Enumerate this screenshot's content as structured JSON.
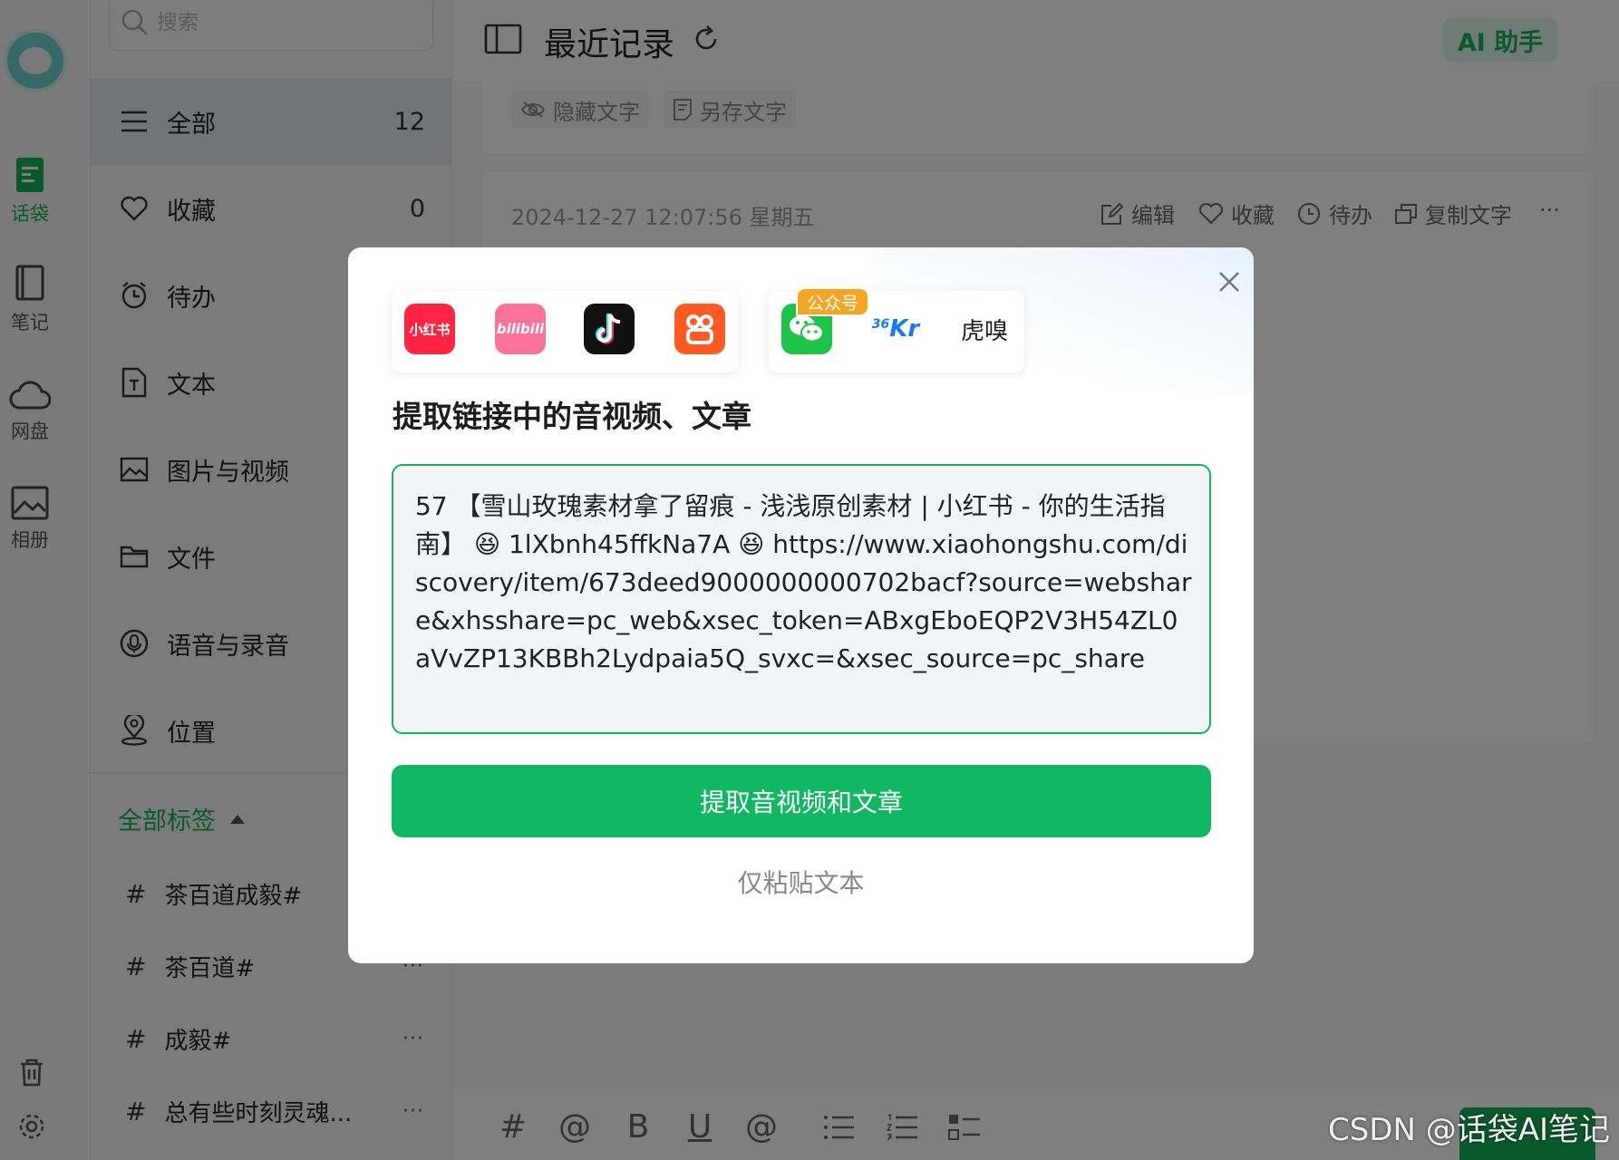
{
  "rail": {
    "items": [
      {
        "label": "话袋",
        "icon": "doc-bag-icon",
        "active": true
      },
      {
        "label": "笔记",
        "icon": "notebook-icon",
        "active": false
      },
      {
        "label": "网盘",
        "icon": "cloud-icon",
        "active": false
      },
      {
        "label": "相册",
        "icon": "image-icon",
        "active": false
      }
    ],
    "bottom": [
      "trash-icon",
      "settings-icon"
    ]
  },
  "sidebar": {
    "search_placeholder": "搜索",
    "categories": [
      {
        "label": "全部",
        "count": "12",
        "icon": "menu-icon"
      },
      {
        "label": "收藏",
        "count": "0",
        "icon": "heart-icon"
      },
      {
        "label": "待办",
        "count": "",
        "icon": "alarm-icon"
      },
      {
        "label": "文本",
        "count": "",
        "icon": "text-file-icon"
      },
      {
        "label": "图片与视频",
        "count": "",
        "icon": "image-icon"
      },
      {
        "label": "文件",
        "count": "",
        "icon": "folder-icon"
      },
      {
        "label": "语音与录音",
        "count": "",
        "icon": "microphone-icon"
      },
      {
        "label": "位置",
        "count": "",
        "icon": "location-icon"
      }
    ],
    "tags_header": "全部标签",
    "tags": [
      {
        "hash": "#",
        "label": "茶百道成毅#",
        "more": "···"
      },
      {
        "hash": "#",
        "label": "茶百道#",
        "more": "···"
      },
      {
        "hash": "#",
        "label": "成毅#",
        "more": "···"
      },
      {
        "hash": "#",
        "label": "总有些时刻灵魂...",
        "more": "···"
      }
    ]
  },
  "main": {
    "title": "最近记录",
    "ai_button": "AI 助手",
    "top_card_actions": [
      "隐藏文字",
      "另存文字"
    ],
    "entry": {
      "date": "2024-12-27 12:07:56 星期五",
      "actions": [
        "编辑",
        "收藏",
        "待办",
        "复制文字"
      ],
      "more": "···"
    },
    "editor_tools": [
      "#",
      "@",
      "B",
      "U",
      "@",
      "list",
      "ordered-list",
      "checklist"
    ]
  },
  "dialog": {
    "platforms_group1": [
      {
        "name": "小红书",
        "icon": "xiaohongshu-icon",
        "color": "#ff2442"
      },
      {
        "name": "bilibili",
        "icon": "bilibili-icon",
        "color": "#fb7299"
      },
      {
        "name": "抖音",
        "icon": "douyin-icon",
        "color": "#111111"
      },
      {
        "name": "快手",
        "icon": "kuaishou-icon",
        "color": "#ff5a22"
      }
    ],
    "platforms_group2": [
      {
        "name": "微信",
        "icon": "wechat-icon",
        "color": "#1fc34a"
      },
      {
        "name": "36Kr",
        "icon": "36kr-icon",
        "color": "#1677ff"
      },
      {
        "name": "虎嗅",
        "icon": "huxiu-icon",
        "color": "#222222"
      }
    ],
    "platform_labels": {
      "xhs": "小红书",
      "bili": "bilibili",
      "kr": "Kr",
      "kr_sup": "36",
      "huxiu": "虎嗅"
    },
    "badge": "公众号",
    "title": "提取链接中的音视频、文章",
    "link_text": "57 【雪山玫瑰素材拿了留痕 - 浅浅原创素材 | 小红书 - 你的生活指南】 😆 1lXbnh45ffkNa7A 😆 https://www.xiaohongshu.com/discovery/item/673deed9000000000702bacf?source=webshare&xhsshare=pc_web&xsec_token=ABxgEboEQP2V3H54ZL0aVvZP13KBBh2Lydpaia5Q_svxc=&xsec_source=pc_share",
    "extract_button": "提取音视频和文章",
    "paste_only": "仅粘贴文本"
  },
  "watermark": "CSDN @话袋AI笔记"
}
